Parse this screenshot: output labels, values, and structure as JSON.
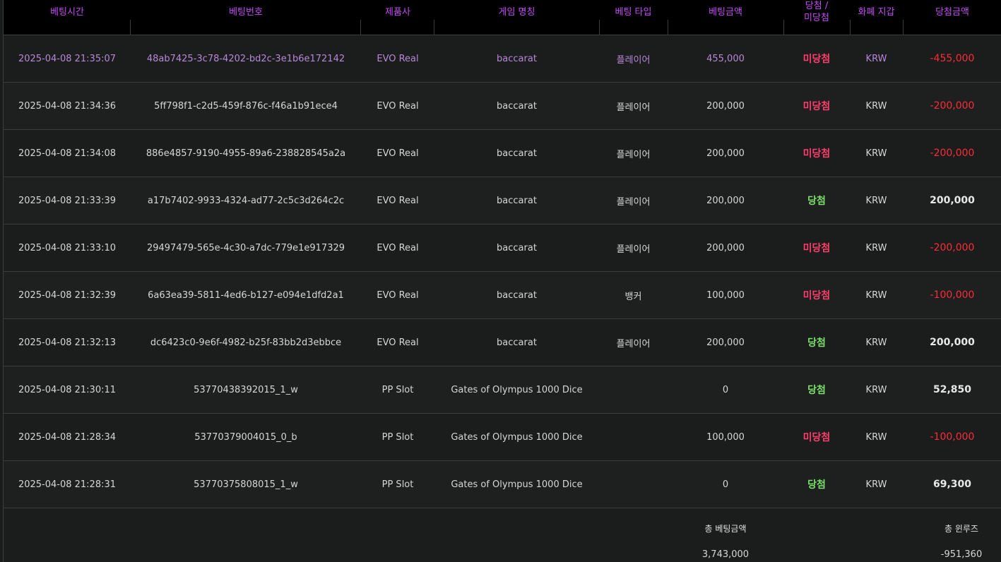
{
  "headers": {
    "bet_time": "베팅시간",
    "bet_id": "베팅번호",
    "provider": "제품사",
    "game_name": "게임 명칭",
    "bet_type": "베팅 타입",
    "bet_amount": "베팅금액",
    "result_line1": "당첨 /",
    "result_line2": "미당첨",
    "wallet": "화폐 지갑",
    "win_amount": "당첨금액"
  },
  "rows": [
    {
      "time": "2025-04-08 21:35:07",
      "id": "48ab7425-3c78-4202-bd2c-3e1b6e172142",
      "provider": "EVO Real",
      "game": "baccarat",
      "type": "플레이어",
      "bet": "455,000",
      "result": "미당첨",
      "wallet": "KRW",
      "amount": "-455,000"
    },
    {
      "time": "2025-04-08 21:34:36",
      "id": "5ff798f1-c2d5-459f-876c-f46a1b91ece4",
      "provider": "EVO Real",
      "game": "baccarat",
      "type": "플레이어",
      "bet": "200,000",
      "result": "미당첨",
      "wallet": "KRW",
      "amount": "-200,000"
    },
    {
      "time": "2025-04-08 21:34:08",
      "id": "886e4857-9190-4955-89a6-238828545a2a",
      "provider": "EVO Real",
      "game": "baccarat",
      "type": "플레이어",
      "bet": "200,000",
      "result": "미당첨",
      "wallet": "KRW",
      "amount": "-200,000"
    },
    {
      "time": "2025-04-08 21:33:39",
      "id": "a17b7402-9933-4324-ad77-2c5c3d264c2c",
      "provider": "EVO Real",
      "game": "baccarat",
      "type": "플레이어",
      "bet": "200,000",
      "result": "당첨",
      "wallet": "KRW",
      "amount": "200,000"
    },
    {
      "time": "2025-04-08 21:33:10",
      "id": "29497479-565e-4c30-a7dc-779e1e917329",
      "provider": "EVO Real",
      "game": "baccarat",
      "type": "플레이어",
      "bet": "200,000",
      "result": "미당첨",
      "wallet": "KRW",
      "amount": "-200,000"
    },
    {
      "time": "2025-04-08 21:32:39",
      "id": "6a63ea39-5811-4ed6-b127-e094e1dfd2a1",
      "provider": "EVO Real",
      "game": "baccarat",
      "type": "뱅커",
      "bet": "100,000",
      "result": "미당첨",
      "wallet": "KRW",
      "amount": "-100,000"
    },
    {
      "time": "2025-04-08 21:32:13",
      "id": "dc6423c0-9e6f-4982-b25f-83bb2d3ebbce",
      "provider": "EVO Real",
      "game": "baccarat",
      "type": "플레이어",
      "bet": "200,000",
      "result": "당첨",
      "wallet": "KRW",
      "amount": "200,000"
    },
    {
      "time": "2025-04-08 21:30:11",
      "id": "53770438392015_1_w",
      "provider": "PP Slot",
      "game": "Gates of Olympus 1000 Dice",
      "type": "",
      "bet": "0",
      "result": "당첨",
      "wallet": "KRW",
      "amount": "52,850"
    },
    {
      "time": "2025-04-08 21:28:34",
      "id": "53770379004015_0_b",
      "provider": "PP Slot",
      "game": "Gates of Olympus 1000 Dice",
      "type": "",
      "bet": "100,000",
      "result": "미당첨",
      "wallet": "KRW",
      "amount": "-100,000"
    },
    {
      "time": "2025-04-08 21:28:31",
      "id": "53770375808015_1_w",
      "provider": "PP Slot",
      "game": "Gates of Olympus 1000 Dice",
      "type": "",
      "bet": "0",
      "result": "당첨",
      "wallet": "KRW",
      "amount": "69,300"
    }
  ],
  "summary": {
    "total_bet_label": "총 베팅금액",
    "total_bet_value": "3,743,000",
    "total_winloss_label": "총 윈루즈",
    "total_winloss_value": "-951,360"
  },
  "colors": {
    "header_text": "#c34cf5",
    "lose": "#ff3d6b",
    "win": "#7ae06a",
    "negative_amount": "#ff2b36"
  }
}
